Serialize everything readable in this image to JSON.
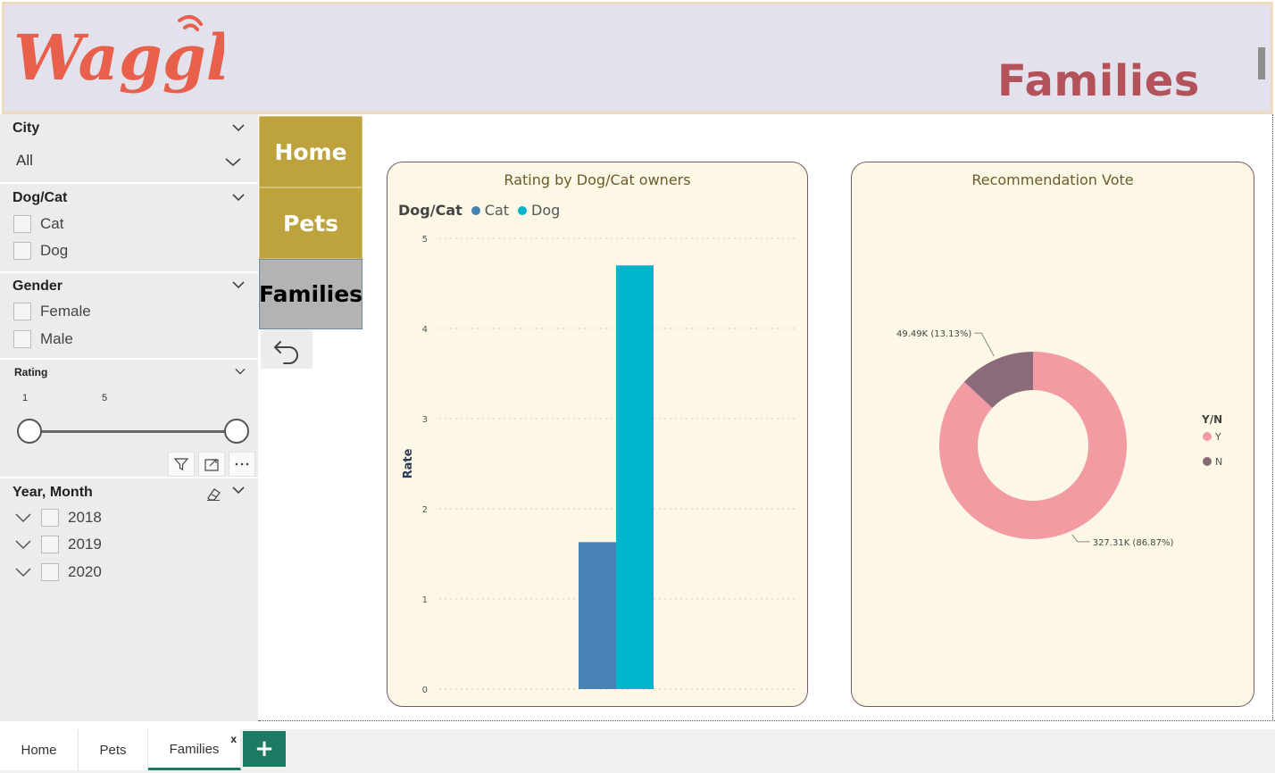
{
  "header": {
    "logo_text": "Waggle",
    "page_title": "Families"
  },
  "filters": {
    "city": {
      "title": "City",
      "value": "All"
    },
    "dog_cat": {
      "title": "Dog/Cat",
      "options": [
        "Cat",
        "Dog"
      ]
    },
    "gender": {
      "title": "Gender",
      "options": [
        "Female",
        "Male"
      ]
    },
    "rating": {
      "title": "Rating",
      "min_label": "1",
      "max_label": "5",
      "range": [
        1,
        5
      ]
    },
    "year_month": {
      "title": "Year, Month",
      "years": [
        "2018",
        "2019",
        "2020"
      ]
    }
  },
  "nav": {
    "home": "Home",
    "pets": "Pets",
    "families": "Families"
  },
  "colors": {
    "cat": "#4682b4",
    "dog": "#00b5cc",
    "yes": "#f29ba3",
    "no": "#8b6b79",
    "nav_gold": "#bea23e",
    "heading": "#b3525a",
    "tab_accent": "#1c7a62"
  },
  "chart_data": [
    {
      "type": "bar",
      "title": "Rating by Dog/Cat owners",
      "legend_title": "Dog/Cat",
      "ylabel": "Rate",
      "ylim": [
        0,
        5
      ],
      "yticks": [
        "0",
        "1",
        "2",
        "3",
        "4",
        "5"
      ],
      "series": [
        {
          "name": "Cat",
          "values": [
            1.63
          ]
        },
        {
          "name": "Dog",
          "values": [
            4.7
          ]
        }
      ],
      "grid": true,
      "legend_position": "top-left"
    },
    {
      "type": "pie",
      "title": "Recommendation Vote",
      "legend_title": "Y/N",
      "legend_position": "right",
      "slices": [
        {
          "name": "Y",
          "value": 327.31,
          "percent": 86.87,
          "label": "327.31K (86.87%)"
        },
        {
          "name": "N",
          "value": 49.49,
          "percent": 13.13,
          "label": "49.49K (13.13%)"
        }
      ]
    }
  ],
  "tabs": {
    "items": [
      "Home",
      "Pets",
      "Families"
    ],
    "active": "Families",
    "close": "x",
    "add": "+"
  }
}
